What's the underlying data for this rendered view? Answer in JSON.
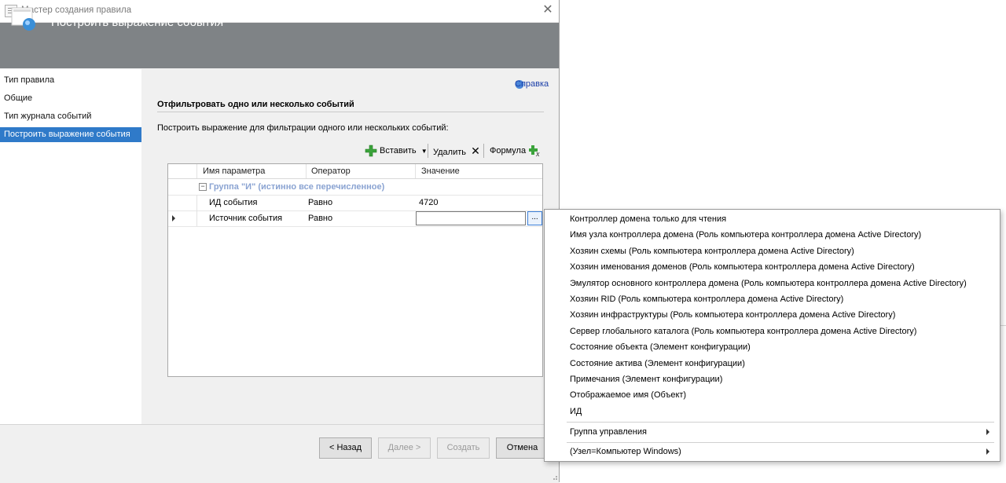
{
  "window": {
    "title": "Мастер создания правила"
  },
  "header": {
    "title": "Построить выражение события"
  },
  "nav": {
    "items": [
      "Тип правила",
      "Общие",
      "Тип журнала событий",
      "Построить выражение события"
    ],
    "active_index": 3
  },
  "help": {
    "label": "Справка"
  },
  "section": {
    "title": "Отфильтровать одно или несколько событий",
    "instruction": "Построить выражение для фильтрации одного или нескольких событий:"
  },
  "toolbar": {
    "insert_label": "Вставить",
    "delete_label": "Удалить",
    "formula_label": "Формула"
  },
  "grid": {
    "columns": [
      "Имя параметра",
      "Оператор",
      "Значение"
    ],
    "group_label": "Группа \"И\" (истинно все перечисленное)",
    "rows": [
      {
        "name": "ИД события",
        "operator": "Равно",
        "value": "4720"
      },
      {
        "name": "Источник события",
        "operator": "Равно",
        "value": ""
      }
    ],
    "ellipsis": "..."
  },
  "footer": {
    "back": "< Назад",
    "next": "Далее >",
    "create": "Создать",
    "cancel": "Отмена"
  },
  "popup": {
    "items": [
      "Контроллер домена только для чтения",
      "Имя узла контроллера домена (Роль компьютера контроллера домена Active Directory)",
      "Хозяин схемы (Роль компьютера контроллера домена Active Directory)",
      "Хозяин именования доменов (Роль компьютера контроллера домена Active Directory)",
      "Эмулятор основного контроллера домена (Роль компьютера контроллера домена Active Directory)",
      "Хозяин RID (Роль компьютера контроллера домена Active Directory)",
      "Хозяин инфраструктуры (Роль компьютера контроллера домена Active Directory)",
      "Сервер глобального каталога (Роль компьютера контроллера домена Active Directory)",
      "Состояние объекта (Элемент конфигурации)",
      "Состояние актива (Элемент конфигурации)",
      "Примечания (Элемент конфигурации)",
      "Отображаемое имя (Объект)",
      "ИД"
    ],
    "submenus": [
      "Группа управления",
      "(Узел=Компьютер Windows)"
    ]
  }
}
